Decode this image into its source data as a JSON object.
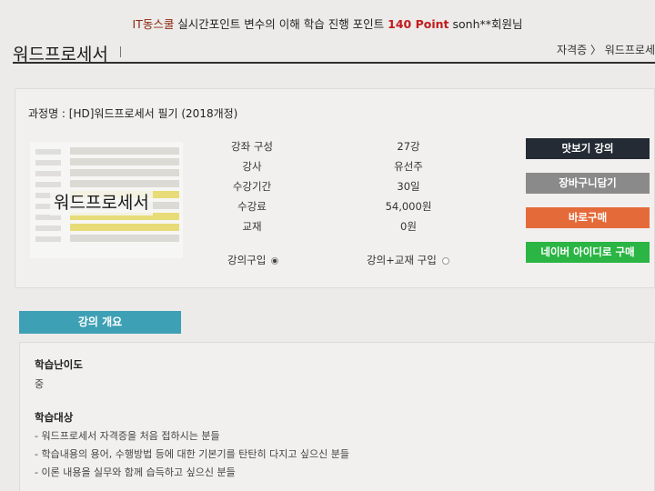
{
  "topbar": {
    "brand": "IT동스쿨",
    "message": " 실시간포인트 변수의 이해 학습 진행 포인트 ",
    "points": "140 Point",
    "user": " sonh**회원님"
  },
  "header": {
    "title": "워드프로세서",
    "breadcrumb": "자격증 〉 워드프로세"
  },
  "course": {
    "name": "과정명 : [HD]워드프로세서 필기 (2018개정)",
    "thumbnail_text": "워드프로세서",
    "info": [
      {
        "label": "강좌 구성",
        "value": "27강"
      },
      {
        "label": "강사",
        "value": "유선주"
      },
      {
        "label": "수강기간",
        "value": "30일"
      },
      {
        "label": "수강료",
        "value": "54,000원"
      },
      {
        "label": "교재",
        "value": "0원"
      }
    ],
    "options": [
      {
        "label": "강의구입",
        "selected": true
      },
      {
        "label": "강의+교재 구입",
        "selected": false
      }
    ]
  },
  "buttons": {
    "preview": "맛보기 강의",
    "cart": "장바구니담기",
    "buy": "바로구매",
    "naver": "네이버 아이디로 구매"
  },
  "overview": {
    "tab_label": "강의 개요",
    "difficulty_title": "학습난이도",
    "difficulty_value": "중",
    "target_title": "학습대상",
    "targets": [
      "- 워드프로세서 자격증을 처음 접하시는 분들",
      "- 학습내용의 용어, 수행방법 등에 대한 기본기를 탄탄히 다지고 싶으신 분들",
      "- 이론 내용을 실무와 함께 습득하고 싶으신 분들"
    ]
  },
  "colors": {
    "preview": "#242b35",
    "cart": "#8a8a8a",
    "buy": "#e56a3a",
    "naver": "#2bb544",
    "tab": "#3ea0b5",
    "points": "#c21b1b"
  }
}
